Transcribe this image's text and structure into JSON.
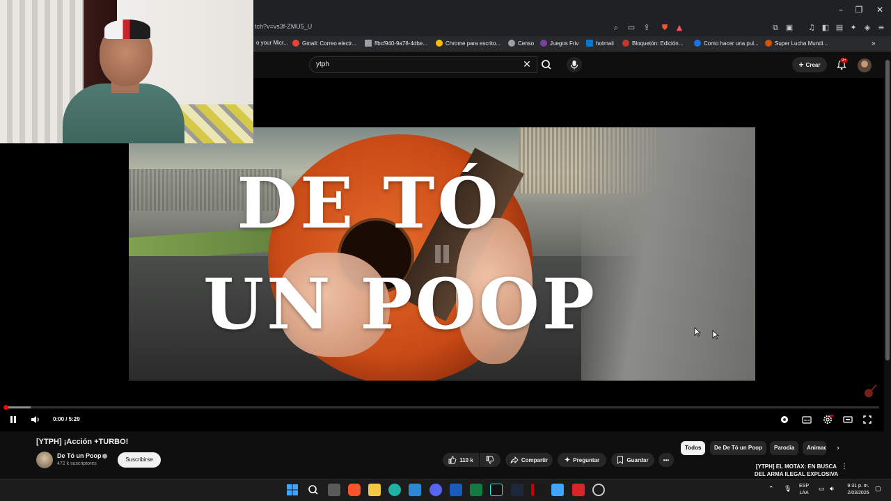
{
  "browser": {
    "url": "tch?v=vs3f-ZMU5_U",
    "bookmarks": [
      {
        "label": "o your Micr...",
        "color": "#4a4a4a"
      },
      {
        "label": "Gmail: Correo electr...",
        "color": "#ea4335"
      },
      {
        "label": "ffbcf940-9a78-4dbe...",
        "color": "#9aa0a6"
      },
      {
        "label": "Chrome para escrito...",
        "color": "#fbbc05"
      },
      {
        "label": "Censo",
        "color": "#9aa0a6"
      },
      {
        "label": "Juegos Friv",
        "color": "#7b3fa0"
      },
      {
        "label": "hotmail",
        "color": "#0078d4"
      },
      {
        "label": "Bloquetón: Edición...",
        "color": "#c0392b"
      },
      {
        "label": "Como hacer una pul...",
        "color": "#1a73e8"
      },
      {
        "label": "Super Lucha Mundi...",
        "color": "#d35400"
      }
    ]
  },
  "youtube": {
    "search_query": "ytph",
    "create_label": "Crear",
    "notification_count": "9+"
  },
  "video": {
    "title_line1": "DE TÓ",
    "title_line2": "UN POOP",
    "time": "0:00 / 5:29",
    "progress_fraction": 0.0,
    "title": "[YTPH] ¡Acción +TURBO!",
    "channel": "De Tó un Poop",
    "subscribers": "472 k suscriptores",
    "subscribe_label": "Suscribirse",
    "likes": "110 k",
    "share_label": "Compartir",
    "ask_label": "Preguntar",
    "save_label": "Guardar"
  },
  "chips": [
    "Todos",
    "De De Tó un Poop",
    "Parodia",
    "Animac"
  ],
  "recommendation": {
    "title": "[YTPH] EL MOTAX: EN BUSCA DEL ARMA ILEGAL EXPLOSIVA"
  },
  "taskbar": {
    "lang1": "ESP",
    "lang2": "LAA",
    "time": "9:31 p. m.",
    "date": "2/03/2026"
  },
  "colors": {
    "brand_red": "#ff0000",
    "bg": "#0f0f0f",
    "pill": "#272727"
  }
}
